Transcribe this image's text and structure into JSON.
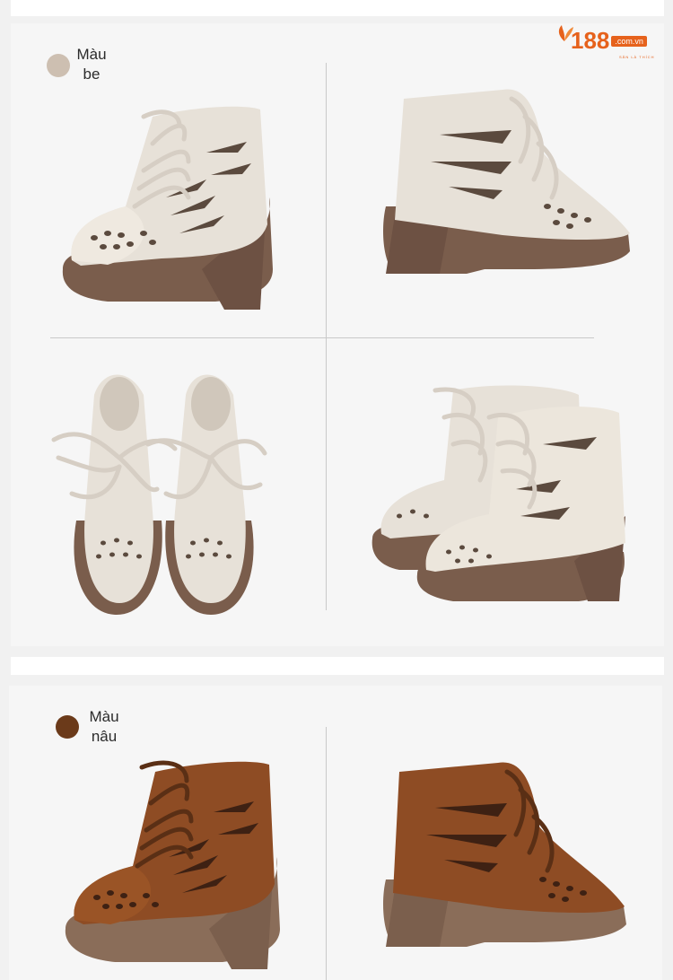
{
  "brand": {
    "number": "188",
    "domain": ".com.vn",
    "tagline": "SĂN LÀ THÍCH",
    "color": "#e6621c"
  },
  "variants": [
    {
      "label_line1": "Màu",
      "label_line2": "be",
      "swatch_color": "#cdbfb1",
      "upper_color": "#e7e1d8",
      "sole_color": "#7a5d4c",
      "lace_color": "#d6cec4"
    },
    {
      "label_line1": "Màu",
      "label_line2": "nâu",
      "swatch_color": "#6b3a1a",
      "upper_color": "#8e4c24",
      "sole_color": "#8a6d59",
      "lace_color": "#5a2f15"
    }
  ],
  "photos": [
    {
      "name": "beige-boot-side-view",
      "icon": "boot-side"
    },
    {
      "name": "beige-boot-back-side-view",
      "icon": "boot-back"
    },
    {
      "name": "beige-boots-top-view",
      "icon": "boots-top"
    },
    {
      "name": "beige-boots-pair-view",
      "icon": "boots-pair"
    },
    {
      "name": "brown-boot-side-view",
      "icon": "boot-side"
    },
    {
      "name": "brown-boot-back-side-view",
      "icon": "boot-back"
    }
  ]
}
